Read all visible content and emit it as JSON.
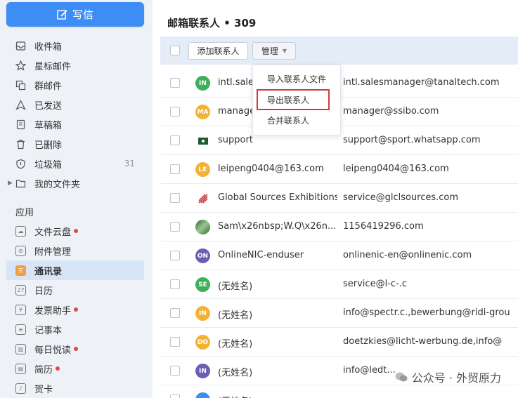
{
  "compose": {
    "label": "写信"
  },
  "nav": {
    "inbox": "收件箱",
    "starred": "星标邮件",
    "group": "群邮件",
    "sent": "已发送",
    "drafts": "草稿箱",
    "deleted": "已删除",
    "spam": "垃圾箱",
    "spam_count": "31",
    "folders": "我的文件夹"
  },
  "apps": {
    "title": "应用",
    "items": [
      "文件云盘",
      "附件管理",
      "通讯录",
      "日历",
      "发票助手",
      "记事本",
      "每日悦读",
      "简历",
      "贺卡"
    ]
  },
  "main": {
    "title": "邮箱联系人 • 309",
    "add_button": "添加联系人",
    "manage_button": "管理"
  },
  "dropdown": {
    "items": [
      "导入联系人文件",
      "导出联系人",
      "合并联系人"
    ]
  },
  "contacts": [
    {
      "avatar": "IN",
      "color": "#3fae5a",
      "name": "intl.sales",
      "email": "intl.salesmanager@tanaltech.com"
    },
    {
      "avatar": "MA",
      "color": "#f3b233",
      "name": "manage",
      "email": "manager@ssibo.com"
    },
    {
      "avatar": "",
      "color": "#ffffff",
      "name": "support",
      "email": "support@sport.whatsapp.com"
    },
    {
      "avatar": "LE",
      "color": "#f3b233",
      "name": "leipeng0404@163.com",
      "email": "leipeng0404@163.com"
    },
    {
      "avatar": "",
      "color": "#ffffff",
      "name": "Global Sources Exhibitions",
      "email": "service@glclsources.com"
    },
    {
      "avatar": "",
      "color": "#4d8a4a",
      "name": "Sam\\x26nbsp;W.Q\\x26n...",
      "email": "1156419296.com"
    },
    {
      "avatar": "ON",
      "color": "#6b5fb5",
      "name": "OnlineNIC-enduser",
      "email": "onlinenic-en@onlinenic.com"
    },
    {
      "avatar": "SE",
      "color": "#3fae5a",
      "name": "(无姓名)",
      "email": "service@l-c-.c"
    },
    {
      "avatar": "IN",
      "color": "#f3b233",
      "name": "(无姓名)",
      "email": "info@spectr.c.,bewerbung@ridi-grou"
    },
    {
      "avatar": "DO",
      "color": "#f3b233",
      "name": "(无姓名)",
      "email": "doetzkies@licht-werbung.de,info@"
    },
    {
      "avatar": "IN",
      "color": "#6b5fb5",
      "name": "(无姓名)",
      "email": "info@ledt..."
    },
    {
      "avatar": "",
      "color": "#3d8df5",
      "name": "(无姓名)",
      "email": ""
    }
  ],
  "watermark": "公众号 · 外贸原力"
}
